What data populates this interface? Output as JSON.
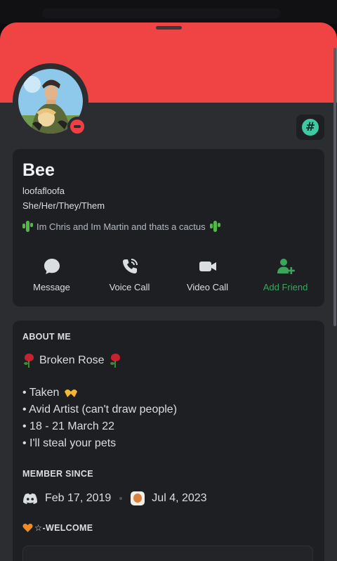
{
  "colors": {
    "banner": "#f04444",
    "sheet": "#2b2d31",
    "card": "#1e1f22",
    "add_friend_green": "#3ba55d",
    "dnd_red": "#f23f43",
    "badge_teal": "#3fc8a1"
  },
  "profile": {
    "display_name": "Bee",
    "username": "loofafloofa",
    "pronouns": "She/Her/They/Them",
    "custom_status": "Im Chris and Im Martin and thats a cactus",
    "status": "do-not-disturb",
    "badge_symbol": "#"
  },
  "actions": [
    {
      "label": "Message",
      "icon": "chat-bubble-icon"
    },
    {
      "label": "Voice Call",
      "icon": "phone-icon"
    },
    {
      "label": "Video Call",
      "icon": "video-camera-icon"
    },
    {
      "label": "Add Friend",
      "icon": "add-friend-icon"
    }
  ],
  "about": {
    "heading": "ABOUT ME",
    "title_line": "Broken Rose",
    "bullets": [
      "• Taken",
      "• Avid Artist (can't draw people)",
      "• 18 - 21 March 22",
      "• I'll steal your pets"
    ]
  },
  "member_since": {
    "heading": "MEMBER SINCE",
    "discord_date": "Feb 17, 2019",
    "server_date": "Jul 4, 2023"
  },
  "roles": {
    "label": "☆-WELCOME"
  }
}
